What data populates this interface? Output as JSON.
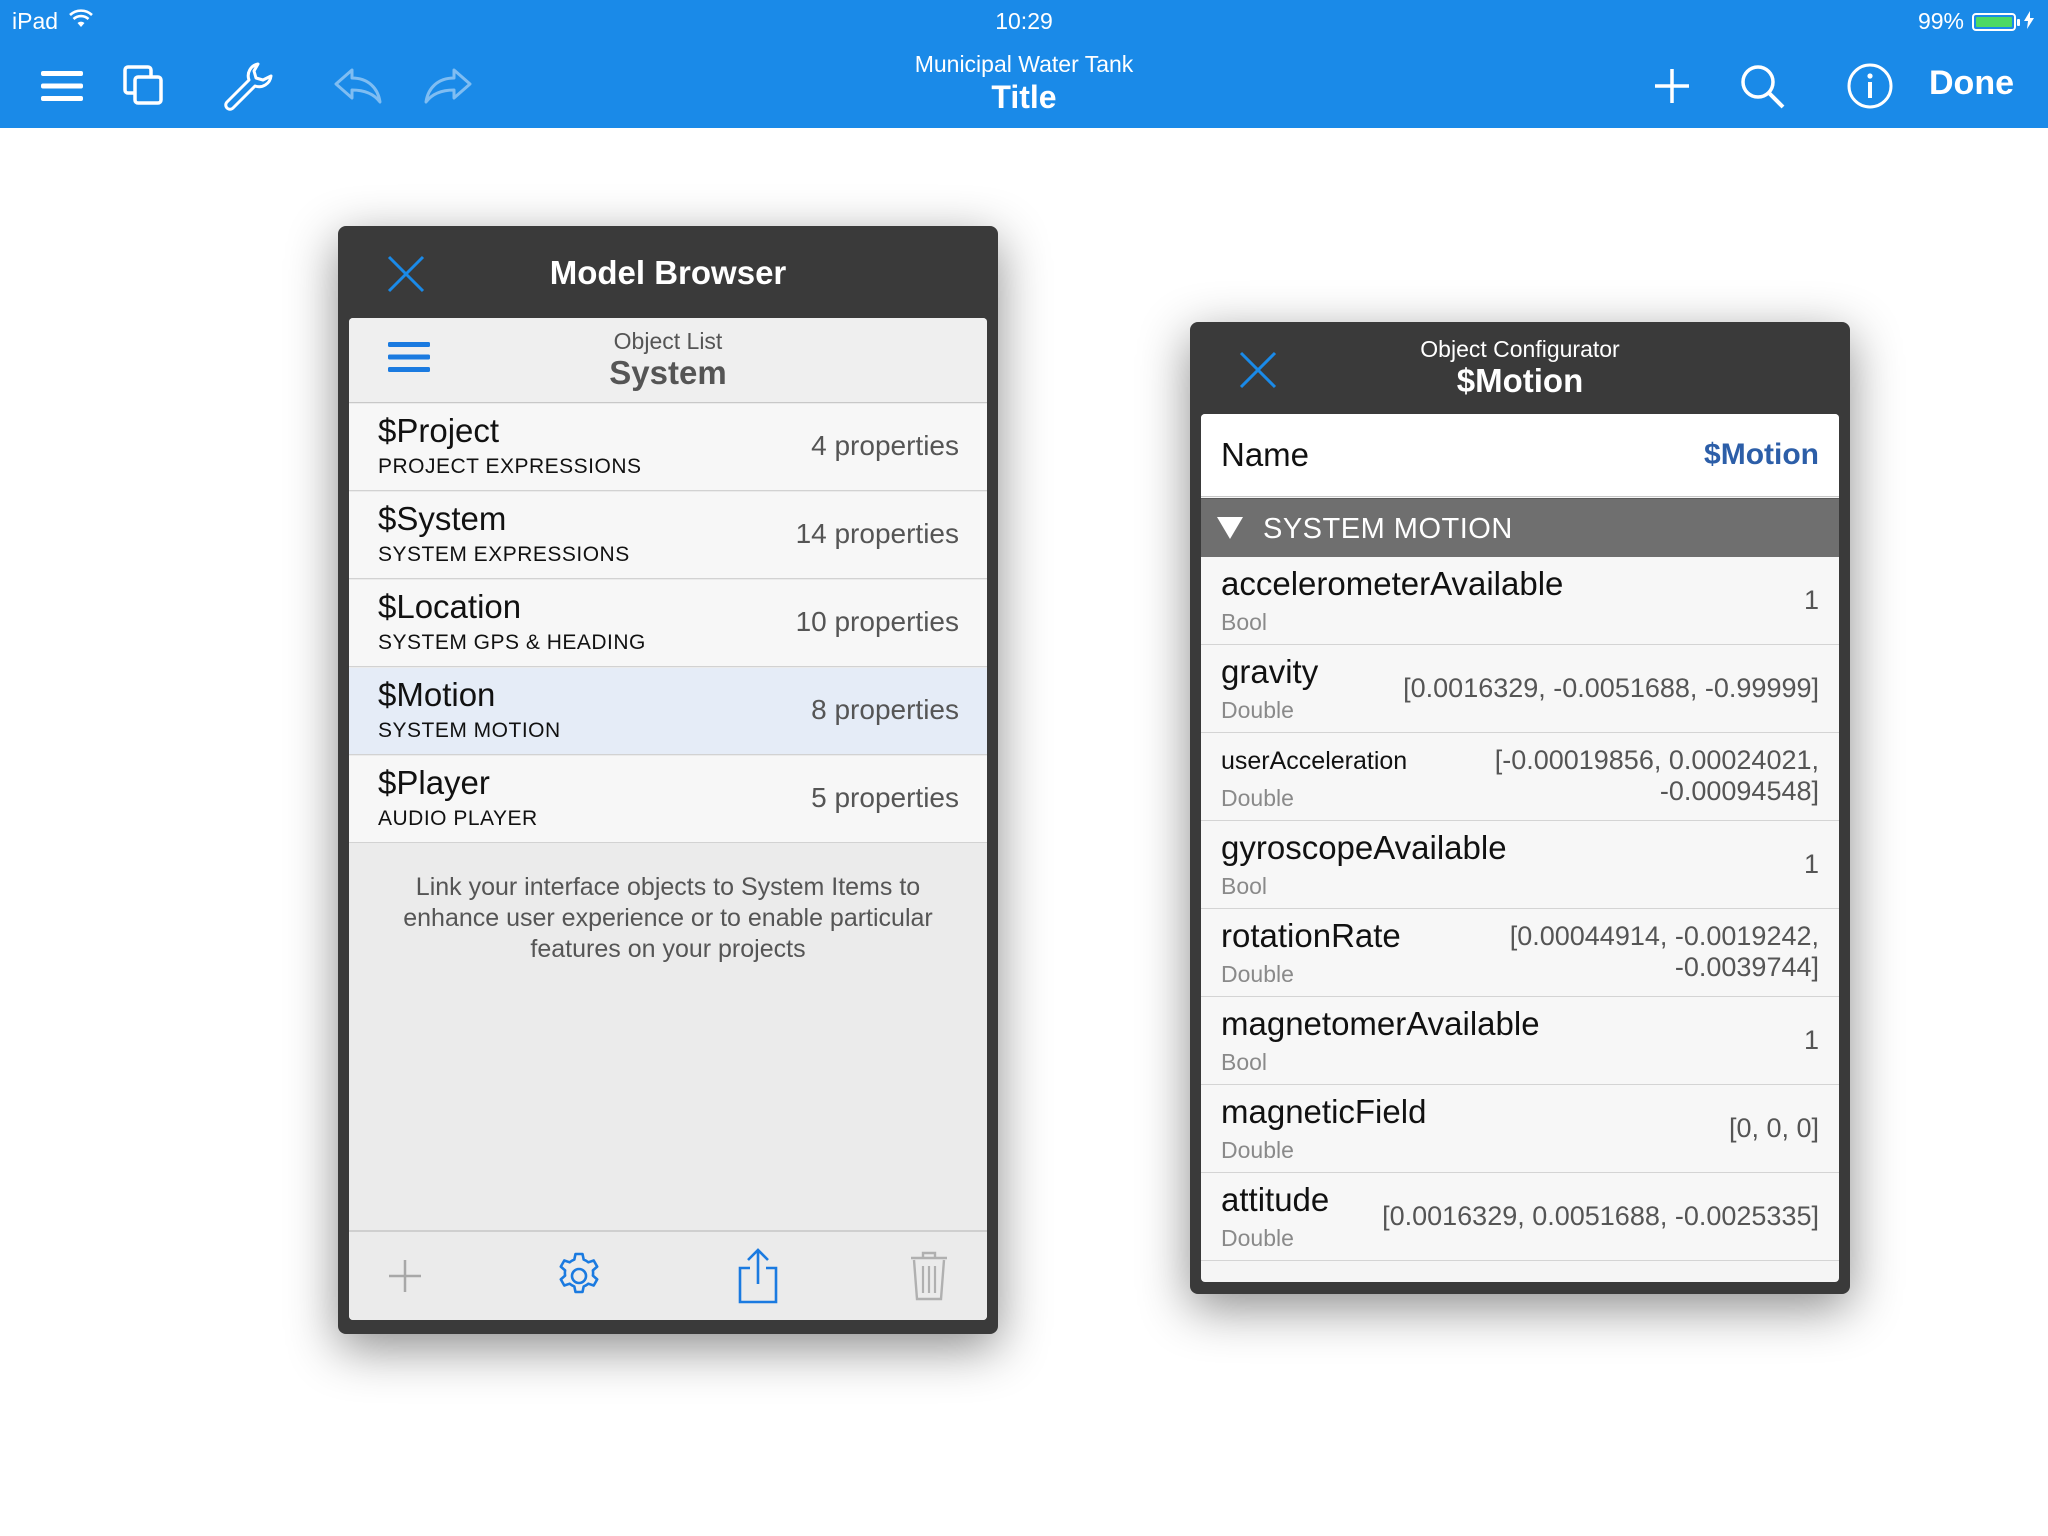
{
  "status_bar": {
    "device": "iPad",
    "time": "10:29",
    "battery": "99%",
    "battery_level": 0.99
  },
  "toolbar": {
    "doc_subtitle": "Municipal Water Tank",
    "doc_title": "Title",
    "done_label": "Done",
    "icons": [
      "menu-icon",
      "pages-icon",
      "wrench-icon",
      "undo-icon",
      "redo-icon",
      "plus-icon",
      "search-icon",
      "info-icon"
    ]
  },
  "model_browser": {
    "title": "Model Browser",
    "list_subtitle": "Object List",
    "list_title": "System",
    "items": [
      {
        "name": "$Project",
        "desc": "PROJECT EXPRESSIONS",
        "count": "4 properties",
        "selected": false
      },
      {
        "name": "$System",
        "desc": "SYSTEM EXPRESSIONS",
        "count": "14 properties",
        "selected": false
      },
      {
        "name": "$Location",
        "desc": "SYSTEM GPS & HEADING",
        "count": "10 properties",
        "selected": false
      },
      {
        "name": "$Motion",
        "desc": "SYSTEM MOTION",
        "count": "8 properties",
        "selected": true
      },
      {
        "name": "$Player",
        "desc": "AUDIO PLAYER",
        "count": "5 properties",
        "selected": false
      }
    ],
    "note": "Link your interface objects to System Items to enhance user experience or to enable particular features on your projects",
    "bottom_icons": [
      "plus-icon",
      "gear-icon",
      "share-icon",
      "trash-icon"
    ]
  },
  "object_configurator": {
    "subtitle": "Object Configurator",
    "title": "$Motion",
    "name_label": "Name",
    "name_value": "$Motion",
    "section": "SYSTEM MOTION",
    "properties": [
      {
        "name": "accelerometerAvailable",
        "type": "Bool",
        "value": "1"
      },
      {
        "name": "gravity",
        "type": "Double",
        "value": "[0.0016329, -0.0051688, -0.99999]"
      },
      {
        "name": "userAcceleration",
        "type": "Double",
        "value": "[-0.00019856, 0.00024021,\n-0.00094548]"
      },
      {
        "name": "gyroscopeAvailable",
        "type": "Bool",
        "value": "1"
      },
      {
        "name": "rotationRate",
        "type": "Double",
        "value": "[0.00044914, -0.0019242,\n-0.0039744]"
      },
      {
        "name": "magnetomerAvailable",
        "type": "Bool",
        "value": "1"
      },
      {
        "name": "magneticField",
        "type": "Double",
        "value": "[0, 0, 0]"
      },
      {
        "name": "attitude",
        "type": "Double",
        "value": "[0.0016329, 0.0051688, -0.0025335]"
      }
    ]
  },
  "colors": {
    "accent": "#1a8ae8",
    "panel_frame": "#3a3a3a",
    "selected_row": "#e5ecf7",
    "name_value": "#2c5ea8",
    "section_header": "#6f6f6f"
  }
}
